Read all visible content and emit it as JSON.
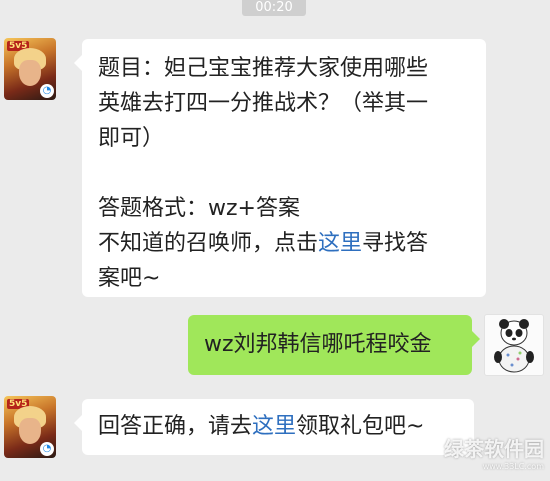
{
  "header": {
    "time": "00:20"
  },
  "messages": [
    {
      "sender": "game",
      "lines": [
        "题目：妲己宝宝推荐大家使用哪些",
        "英雄去打四一分推战术？（举其一",
        "即可）"
      ],
      "format_line": "答题格式：wz+答案",
      "hint_pre": "不知道的召唤师，点击",
      "hint_link": "这里",
      "hint_post": "寻找答",
      "hint_end": "案吧~"
    },
    {
      "sender": "user",
      "text": "wz刘邦韩信哪吒程咬金"
    },
    {
      "sender": "game",
      "text_pre": "回答正确，请去",
      "text_link": "这里",
      "text_post": "领取礼包吧~"
    }
  ],
  "avatars": {
    "game_logo": "5v5",
    "game_badge": "app-badge-icon",
    "user": "panda-icon"
  },
  "watermark": {
    "title": "绿茶软件园",
    "url": "www.33LC.com"
  }
}
